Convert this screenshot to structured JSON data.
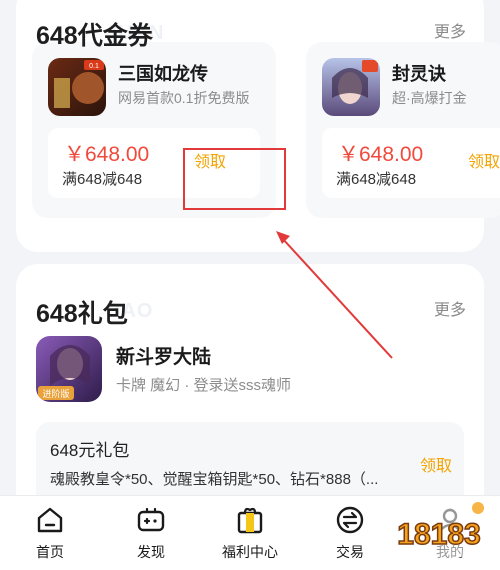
{
  "voucher_section": {
    "title": "648代金券",
    "watermark": "JUAN",
    "more": "更多",
    "cards": [
      {
        "game_name": "三国如龙传",
        "subtitle": "网易首款0.1折免费版",
        "icon": "sanguo-game-icon",
        "price": "￥648.00",
        "condition": "满648减648",
        "claim": "领取"
      },
      {
        "game_name": "封灵诀",
        "subtitle": "超·高爆打金",
        "icon": "fenglingjue-game-icon",
        "price": "￥648.00",
        "condition": "满648减648",
        "claim": "领取"
      }
    ]
  },
  "gift_section": {
    "title": "648礼包",
    "watermark": "BAO",
    "more": "更多",
    "game_name": "新斗罗大陆",
    "tags": "卡牌  魔幻 · 登录送sss魂师",
    "icon": "douluo-game-icon",
    "icon_badge": "进阶版",
    "gift": {
      "title": "648元礼包",
      "content": "魂殿教皇令*50、觉醒宝箱钥匙*50、钻石*888（...",
      "claim": "领取"
    }
  },
  "tabbar": [
    {
      "label": "首页",
      "icon": "home-icon"
    },
    {
      "label": "发现",
      "icon": "gamepad-icon"
    },
    {
      "label": "福利中心",
      "icon": "gift-bag-icon"
    },
    {
      "label": "交易",
      "icon": "exchange-icon"
    },
    {
      "label": "我的",
      "icon": "user-icon"
    }
  ],
  "watermark_logo": "18183",
  "colors": {
    "price_red": "#f14a3c",
    "claim_orange": "#f2a400",
    "annotation_red": "#e23a3a"
  }
}
